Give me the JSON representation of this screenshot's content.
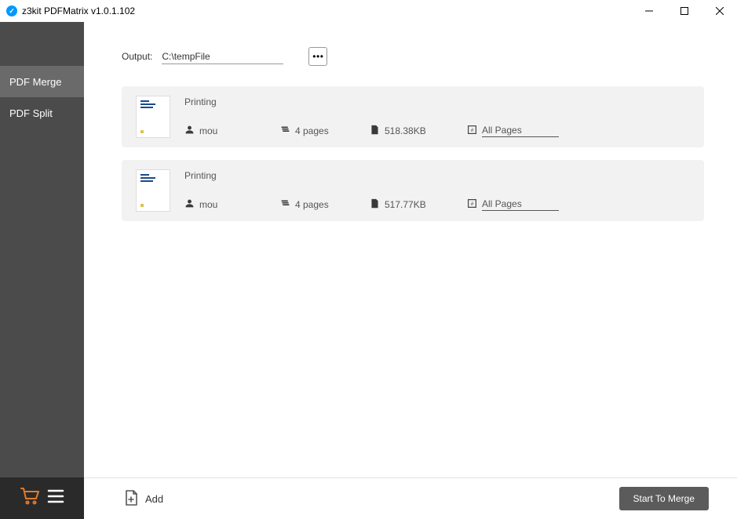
{
  "titlebar": {
    "title": "z3kit PDFMatrix v1.0.1.102"
  },
  "sidebar": {
    "items": [
      {
        "label": "PDF Merge",
        "active": true
      },
      {
        "label": "PDF Split",
        "active": false
      }
    ]
  },
  "output": {
    "label": "Output:",
    "path": "C:\\tempFile"
  },
  "files": [
    {
      "name": "Printing",
      "user": "mou",
      "pages": "4 pages",
      "size": "518.38KB",
      "range": "All Pages"
    },
    {
      "name": "Printing",
      "user": "mou",
      "pages": "4 pages",
      "size": "517.77KB",
      "range": "All Pages"
    }
  ],
  "footer": {
    "add_label": "Add",
    "merge_label": "Start To Merge"
  }
}
